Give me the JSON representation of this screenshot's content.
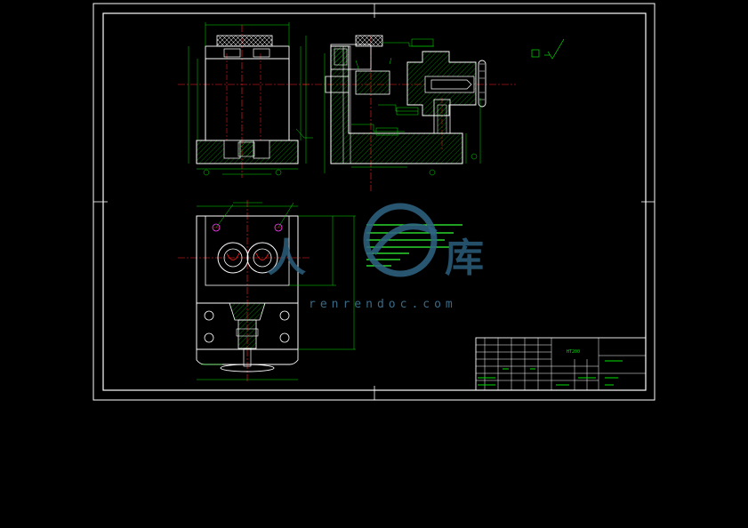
{
  "title_block": {
    "material": "HT200"
  },
  "watermark": {
    "url": "renrendoc.com"
  },
  "colors": {
    "background": "#000000",
    "frame": "#ffffff",
    "outline": "#ffffff",
    "hatch": "#00c000",
    "dimension": "#00e000",
    "centerline": "#ff2020",
    "hidden_line": "#ff40ff",
    "note_text": "#33ff33",
    "watermark": "#2f6484"
  }
}
